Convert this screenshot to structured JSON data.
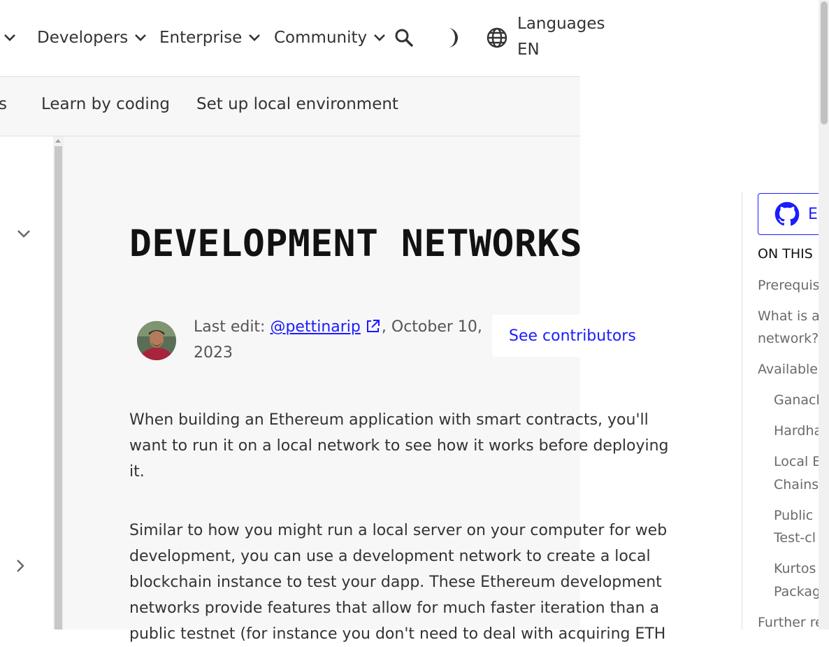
{
  "header": {
    "nav": [
      {
        "label": "Developers"
      },
      {
        "label": "Enterprise"
      },
      {
        "label": "Community"
      }
    ],
    "language": {
      "label": "Languages",
      "code": "EN"
    }
  },
  "subnav": {
    "items": [
      {
        "label": "s"
      },
      {
        "label": "Learn by coding"
      },
      {
        "label": "Set up local environment"
      }
    ]
  },
  "page": {
    "title": "DEVELOPMENT NETWORKS",
    "last_edit_prefix": "Last edit: ",
    "author": "@pettinarip",
    "date_suffix": ", October 10, 2023",
    "contributors_label": "See contributors",
    "paragraphs": [
      "When building an Ethereum application with smart contracts, you'll want to run it on a local network to see how it works before deploying it.",
      "Similar to how you might run a local server on your computer for web development, you can use a development network to create a local blockchain instance to test your dapp. These Ethereum development networks provide features that allow for much faster iteration than a public testnet (for instance you don't need to deal with acquiring ETH"
    ]
  },
  "right_rail": {
    "edit_label": "Ec",
    "on_this_page": "ON THIS",
    "toc": [
      {
        "label": "Prerequis"
      },
      {
        "label": "What is a"
      },
      {
        "label": "network?"
      },
      {
        "label": "Available"
      },
      {
        "label": "Ganacl"
      },
      {
        "label": "Hardha"
      },
      {
        "label": "Local E"
      },
      {
        "label": "Chains"
      },
      {
        "label": "Public"
      },
      {
        "label": "Test-cl"
      },
      {
        "label": "Kurtos"
      },
      {
        "label": "Packag"
      },
      {
        "label": "Further re"
      }
    ]
  },
  "colors": {
    "link": "#1c1cff",
    "main_bg": "#f7f7f7",
    "text": "#333333"
  }
}
